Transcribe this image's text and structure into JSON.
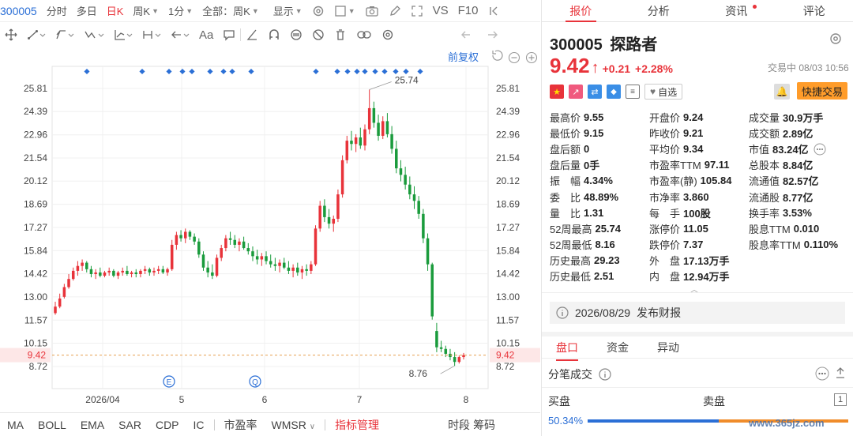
{
  "header": {
    "code": "300005",
    "items": [
      {
        "label": "分时"
      },
      {
        "label": "多日"
      },
      {
        "label": "日K"
      },
      {
        "label": "周K"
      },
      {
        "label": "1分"
      },
      {
        "label": "全部：周K"
      },
      {
        "label": "显示"
      }
    ],
    "vs_label": "VS",
    "f10_label": "F10"
  },
  "drawbar": {
    "aa_label": "Aa"
  },
  "chart_area": {
    "restoration_label": "前复权",
    "price_high_label": "25.74",
    "price_low_label": "8.76",
    "current_price_label": "9.42",
    "e_marker": "E",
    "q_marker": "Q"
  },
  "chart_data": {
    "type": "candlestick",
    "y_ticks": [
      "25.81",
      "24.39",
      "22.96",
      "21.54",
      "20.12",
      "18.69",
      "17.27",
      "15.84",
      "14.42",
      "13.00",
      "11.57",
      "10.15",
      "8.72"
    ],
    "ylim": [
      8.72,
      25.81
    ],
    "x_ticks": [
      "2026/04",
      "5",
      "6",
      "7",
      "8"
    ],
    "current_price": 9.42,
    "period_high": 25.74,
    "period_low": 8.76,
    "candles": [
      [
        12.0,
        12.7,
        11.9,
        12.4
      ],
      [
        12.4,
        13.2,
        12.3,
        12.9
      ],
      [
        13.0,
        13.8,
        12.9,
        13.6
      ],
      [
        13.6,
        14.4,
        13.5,
        14.1
      ],
      [
        14.1,
        14.8,
        14.0,
        14.6
      ],
      [
        14.6,
        15.2,
        14.3,
        14.9
      ],
      [
        14.9,
        15.3,
        14.6,
        15.1
      ],
      [
        15.1,
        15.2,
        14.5,
        14.7
      ],
      [
        14.7,
        14.9,
        14.2,
        14.4
      ],
      [
        14.4,
        14.7,
        14.1,
        14.5
      ],
      [
        14.5,
        14.8,
        14.2,
        14.3
      ],
      [
        14.3,
        14.6,
        14.2,
        14.5
      ],
      [
        14.5,
        14.8,
        14.3,
        14.6
      ],
      [
        14.6,
        14.7,
        14.2,
        14.3
      ],
      [
        14.3,
        14.6,
        14.1,
        14.5
      ],
      [
        14.5,
        14.8,
        14.3,
        14.6
      ],
      [
        14.6,
        14.9,
        14.3,
        14.4
      ],
      [
        14.4,
        14.6,
        14.2,
        14.5
      ],
      [
        14.5,
        14.7,
        14.2,
        14.4
      ],
      [
        14.4,
        14.7,
        14.2,
        14.6
      ],
      [
        14.6,
        14.9,
        14.4,
        14.7
      ],
      [
        14.7,
        14.8,
        14.3,
        14.5
      ],
      [
        14.5,
        14.8,
        14.3,
        14.6
      ],
      [
        14.6,
        14.9,
        14.4,
        14.7
      ],
      [
        14.7,
        14.9,
        14.4,
        14.5
      ],
      [
        14.5,
        14.8,
        14.3,
        14.7
      ],
      [
        14.7,
        16.5,
        14.6,
        16.2
      ],
      [
        16.2,
        17.0,
        15.9,
        16.8
      ],
      [
        16.8,
        17.1,
        16.4,
        16.6
      ],
      [
        16.6,
        17.2,
        16.3,
        17.0
      ],
      [
        17.0,
        17.1,
        16.5,
        16.7
      ],
      [
        16.7,
        16.9,
        16.2,
        16.4
      ],
      [
        16.4,
        16.6,
        15.4,
        15.6
      ],
      [
        15.6,
        15.8,
        14.6,
        14.8
      ],
      [
        14.8,
        15.2,
        14.2,
        14.5
      ],
      [
        14.5,
        15.0,
        14.1,
        14.3
      ],
      [
        14.3,
        15.6,
        14.2,
        15.4
      ],
      [
        15.4,
        16.2,
        15.2,
        16.0
      ],
      [
        16.0,
        16.8,
        15.8,
        16.6
      ],
      [
        16.6,
        17.0,
        16.2,
        16.5
      ],
      [
        16.5,
        16.8,
        16.0,
        16.2
      ],
      [
        16.2,
        16.6,
        15.8,
        16.4
      ],
      [
        16.4,
        16.7,
        15.9,
        16.0
      ],
      [
        16.0,
        16.3,
        15.6,
        15.8
      ],
      [
        15.8,
        16.1,
        15.2,
        15.5
      ],
      [
        15.5,
        15.9,
        15.0,
        15.3
      ],
      [
        15.3,
        15.7,
        14.9,
        15.5
      ],
      [
        15.5,
        15.8,
        15.0,
        15.2
      ],
      [
        15.2,
        15.6,
        14.8,
        15.0
      ],
      [
        15.0,
        15.4,
        14.6,
        14.9
      ],
      [
        14.9,
        15.3,
        14.5,
        15.1
      ],
      [
        15.1,
        15.4,
        14.7,
        14.8
      ],
      [
        14.8,
        15.2,
        14.4,
        14.6
      ],
      [
        14.6,
        15.0,
        14.2,
        14.8
      ],
      [
        14.8,
        15.1,
        14.3,
        14.5
      ],
      [
        14.5,
        14.9,
        14.1,
        14.7
      ],
      [
        14.7,
        15.0,
        14.3,
        14.6
      ],
      [
        14.6,
        15.2,
        14.4,
        15.0
      ],
      [
        15.0,
        17.4,
        14.9,
        17.2
      ],
      [
        17.2,
        18.9,
        17.0,
        18.6
      ],
      [
        18.6,
        19.0,
        17.6,
        17.9
      ],
      [
        17.9,
        18.4,
        17.2,
        17.5
      ],
      [
        17.5,
        18.0,
        17.0,
        17.8
      ],
      [
        17.8,
        19.6,
        17.6,
        19.3
      ],
      [
        19.3,
        21.7,
        19.1,
        21.4
      ],
      [
        21.4,
        22.9,
        21.2,
        22.6
      ],
      [
        22.6,
        23.2,
        22.0,
        22.4
      ],
      [
        22.4,
        23.0,
        21.9,
        22.8
      ],
      [
        22.8,
        23.4,
        22.1,
        22.3
      ],
      [
        22.3,
        23.6,
        22.0,
        23.3
      ],
      [
        23.3,
        25.74,
        23.0,
        24.6
      ],
      [
        24.6,
        25.0,
        23.4,
        23.7
      ],
      [
        23.7,
        24.2,
        22.6,
        22.9
      ],
      [
        22.9,
        24.1,
        22.7,
        23.8
      ],
      [
        23.8,
        24.3,
        22.8,
        23.0
      ],
      [
        23.0,
        23.5,
        21.8,
        22.1
      ],
      [
        22.1,
        22.6,
        20.6,
        20.9
      ],
      [
        20.9,
        21.4,
        20.1,
        20.5
      ],
      [
        20.5,
        21.0,
        19.6,
        19.9
      ],
      [
        19.9,
        20.4,
        19.0,
        19.3
      ],
      [
        19.3,
        19.8,
        18.4,
        18.9
      ],
      [
        18.9,
        19.2,
        17.8,
        18.1
      ],
      [
        18.1,
        18.4,
        16.3,
        16.6
      ],
      [
        16.6,
        16.9,
        14.6,
        15.0
      ],
      [
        15.0,
        15.1,
        11.6,
        11.8
      ],
      [
        10.9,
        11.4,
        9.6,
        9.9
      ],
      [
        9.9,
        10.3,
        9.6,
        9.8
      ],
      [
        9.8,
        10.0,
        9.3,
        9.5
      ],
      [
        9.5,
        9.8,
        9.1,
        9.3
      ],
      [
        9.3,
        9.6,
        8.76,
        9.0
      ],
      [
        9.0,
        9.4,
        8.9,
        9.3
      ],
      [
        9.3,
        9.55,
        9.15,
        9.42
      ]
    ]
  },
  "bottombar": {
    "items": [
      "MA",
      "BOLL",
      "EMA",
      "SAR",
      "CDP",
      "IC"
    ],
    "pe_label": "市盈率",
    "wmsr_label": "WMSR",
    "indicator_label": "指标管理",
    "timeshare_label": "时段",
    "chips_label": "筹码"
  },
  "right_tabs": [
    "报价",
    "分析",
    "资讯",
    "评论"
  ],
  "quote": {
    "code": "300005",
    "name": "探路者",
    "price": "9.42",
    "arrow": "↑",
    "change": "+0.21",
    "change_pct": "+2.28%",
    "status": "交易中 08/03 10:56",
    "watchlist_label": "自选",
    "trade_label": "快捷交易",
    "rows": [
      [
        [
          "最高价",
          "9.55",
          "up"
        ],
        [
          "开盘价",
          "9.24",
          "up"
        ],
        [
          "成交量",
          "30.9万手",
          "n"
        ]
      ],
      [
        [
          "最低价",
          "9.15",
          "down"
        ],
        [
          "昨收价",
          "9.21",
          "n"
        ],
        [
          "成交额",
          "2.89亿",
          "n"
        ]
      ],
      [
        [
          "盘后额",
          "0",
          "n"
        ],
        [
          "平均价",
          "9.34",
          "up"
        ],
        [
          "市值",
          "83.24亿",
          "n"
        ]
      ],
      [
        [
          "盘后量",
          "0手",
          "n"
        ],
        [
          "市盈率TTM",
          "97.11",
          "n"
        ],
        [
          "总股本",
          "8.84亿",
          "n"
        ]
      ],
      [
        [
          "振　幅",
          "4.34%",
          "n"
        ],
        [
          "市盈率(静)",
          "105.84",
          "n"
        ],
        [
          "流通值",
          "82.57亿",
          "n"
        ]
      ],
      [
        [
          "委　比",
          "48.89%",
          "n"
        ],
        [
          "市净率",
          "3.860",
          "n"
        ],
        [
          "流通股",
          "8.77亿",
          "n"
        ]
      ],
      [
        [
          "量　比",
          "1.31",
          "n"
        ],
        [
          "每　手",
          "100股",
          "n"
        ],
        [
          "换手率",
          "3.53%",
          "n"
        ]
      ],
      [
        [
          "52周最高",
          "25.74",
          "up"
        ],
        [
          "涨停价",
          "11.05",
          "up"
        ],
        [
          "股息TTM",
          "0.010",
          "n"
        ]
      ],
      [
        [
          "52周最低",
          "8.16",
          "down"
        ],
        [
          "跌停价",
          "7.37",
          "down"
        ],
        [
          "股息率TTM",
          "0.110%",
          "n"
        ]
      ],
      [
        [
          "历史最高",
          "29.23",
          "up"
        ],
        [
          "外　盘",
          "17.13万手",
          "up"
        ],
        [
          "",
          "",
          " n"
        ]
      ],
      [
        [
          "历史最低",
          "2.51",
          "down"
        ],
        [
          "内　盘",
          "12.94万手",
          "down"
        ],
        [
          "",
          "",
          " n"
        ]
      ]
    ],
    "event_date": "2026/08/29",
    "event_label": "发布财报",
    "subtabs": [
      "盘口",
      "资金",
      "异动"
    ],
    "tick_title": "分笔成交",
    "buy_label": "买盘",
    "sell_label": "卖盘",
    "buy_pct": "50.34%",
    "watermark": "www.365jz.com",
    "colors": {
      "up": "#e8333a",
      "down": "#1a9b3c",
      "accent": "#e8333a",
      "buybar": "#2b6fd6",
      "sellbar": "#f08c2a"
    }
  }
}
